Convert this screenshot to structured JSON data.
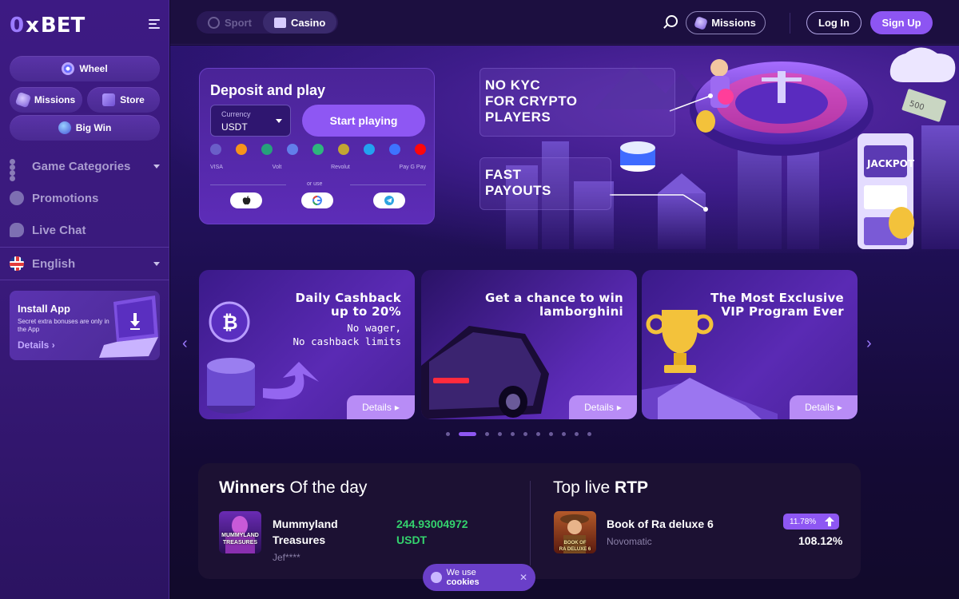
{
  "brand": {
    "logo_zero": "0",
    "logo_x": "x",
    "logo_bet": "BET"
  },
  "colors": {
    "accent": "#8e57f3",
    "sidebar": "#3d1a83",
    "positive": "#34d36e",
    "header": "#1c0f40"
  },
  "sidebar": {
    "quick": {
      "wheel": "Wheel",
      "missions": "Missions",
      "store": "Store",
      "big_win": "Big Win"
    },
    "nav": {
      "categories": "Game Categories",
      "promotions": "Promotions",
      "live_chat": "Live Chat",
      "language": "English"
    },
    "install": {
      "title": "Install App",
      "subtitle": "Secret extra bonuses are only in the App",
      "details": "Details"
    }
  },
  "header": {
    "tabs": {
      "sport": "Sport",
      "casino": "Casino"
    },
    "missions": "Missions",
    "login": "Log In",
    "signup": "Sign Up"
  },
  "deposit": {
    "title": "Deposit and play",
    "currency_label": "Currency",
    "currency_value": "USDT",
    "start": "Start playing",
    "coin_colors": [
      "#6a5ec8",
      "#f7931a",
      "#26a17b",
      "#627eea",
      "#2eb67d",
      "#c2a633",
      "#23a2f0",
      "#3e73ff",
      "#ff060a"
    ],
    "payments": [
      "VISA",
      "Volt",
      "Revolut",
      "Pay G Pay"
    ],
    "or_use": "or use",
    "social": [
      "apple-icon",
      "google-icon",
      "telegram-icon"
    ]
  },
  "hero": {
    "text1": [
      "NO KYC",
      "FOR CRYPTO",
      "PLAYERS"
    ],
    "text2": [
      "FAST",
      "PAYOUTS"
    ],
    "slot_label": "JACKPOT",
    "cash_label": "500"
  },
  "promos": [
    {
      "title": [
        "Daily Cashback",
        "up to 20%"
      ],
      "sub": [
        "No wager,",
        "No cashback limits"
      ],
      "details": "Details"
    },
    {
      "title": [
        "Get a chance to win",
        "lamborghini"
      ],
      "sub": [],
      "details": "Details"
    },
    {
      "title": [
        "The Most Exclusive",
        "VIP Program Ever"
      ],
      "sub": [],
      "details": "Details"
    }
  ],
  "winners": {
    "title_bold": "Winners",
    "title_rest": " Of the day",
    "game": [
      "Mummyland",
      "Treasures"
    ],
    "thumb_label": [
      "MUMMYLAND",
      "TREASURES"
    ],
    "user": "Jef****",
    "amount": [
      "244.93004972",
      "USDT"
    ]
  },
  "rtp": {
    "title_normal": "Top live ",
    "title_bold": "RTP",
    "game": "Book of Ra deluxe 6",
    "thumb_label": [
      "BOOK OF",
      "RA DELUXE 6"
    ],
    "provider": "Novomatic",
    "change": "11.78%",
    "value": "108.12%"
  },
  "cookie": {
    "text": "We use",
    "bold": "cookies",
    "close": "✕"
  }
}
